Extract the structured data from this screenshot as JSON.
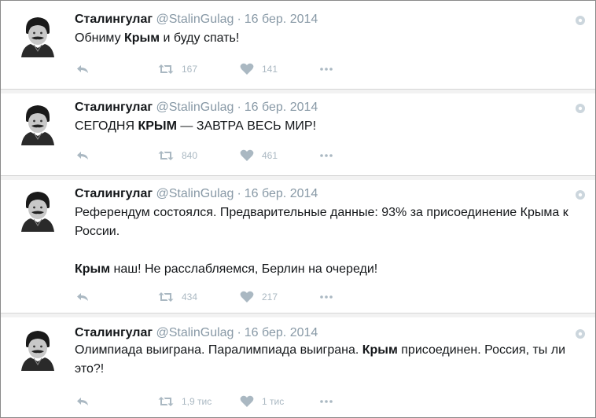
{
  "tweets": [
    {
      "name": "Сталингулаг",
      "handle": "@StalinGulag",
      "dot": "·",
      "date": "16 бер. 2014",
      "text": [
        [
          {
            "t": "Обниму ",
            "b": false
          },
          {
            "t": "Крым",
            "b": true
          },
          {
            "t": " и буду спать!",
            "b": false
          }
        ]
      ],
      "retweets": "167",
      "likes": "141"
    },
    {
      "name": "Сталингулаг",
      "handle": "@StalinGulag",
      "dot": "·",
      "date": "16 бер. 2014",
      "text": [
        [
          {
            "t": "СЕГОДНЯ ",
            "b": false
          },
          {
            "t": "КРЫМ",
            "b": true
          },
          {
            "t": " — ЗАВТРА ВЕСЬ МИР!",
            "b": false
          }
        ]
      ],
      "retweets": "840",
      "likes": "461"
    },
    {
      "name": "Сталингулаг",
      "handle": "@StalinGulag",
      "dot": "·",
      "date": "16 бер. 2014",
      "text": [
        [
          {
            "t": "Референдум состоялся. Предварительные данные: 93% за присоединение Крыма к России.",
            "b": false
          }
        ],
        [],
        [
          {
            "t": "Крым",
            "b": true
          },
          {
            "t": " наш! Не расслабляемся, Берлин на очереди!",
            "b": false
          }
        ]
      ],
      "retweets": "434",
      "likes": "217"
    },
    {
      "name": "Сталингулаг",
      "handle": "@StalinGulag",
      "dot": "·",
      "date": "16 бер. 2014",
      "text": [
        [
          {
            "t": "Олимпиада выиграна. Паралимпиада выиграна. ",
            "b": false
          },
          {
            "t": "Крым",
            "b": true
          },
          {
            "t": " присоединен. Россия, ты ли это?!",
            "b": false
          }
        ]
      ],
      "retweets": "1,9 тис",
      "likes": "1 тис"
    }
  ],
  "colors": {
    "name": "#14171a",
    "meta": "#8899a6",
    "action": "#aab8c2",
    "separator": "#f2f2f2"
  },
  "icons": {
    "reply": "reply-icon",
    "retweet": "retweet-icon",
    "like": "heart-icon",
    "more": "more-icon",
    "settings": "gear-icon",
    "avatar": "avatar"
  }
}
